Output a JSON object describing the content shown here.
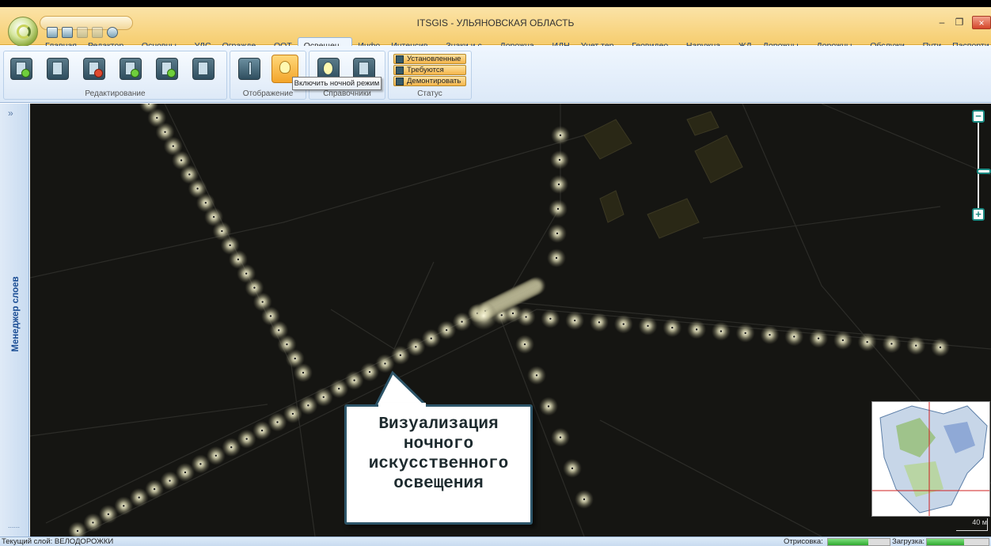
{
  "app": {
    "title": "ITSGIS - УЛЬЯНОВСКАЯ ОБЛАСТЬ",
    "window_buttons": {
      "minimize": "–",
      "restore": "❐",
      "close": "×"
    }
  },
  "ribbon_tabs": [
    "Главная",
    "Редактор...",
    "Основны...",
    "УДС",
    "Огражде...",
    "ООТ",
    "Освещен...",
    "Инфо",
    "Интенсив...",
    "Знаки и с...",
    "Дорожна...",
    "ИДН",
    "Учет тер...",
    "Геовидео...",
    "Наружна...",
    "ЖД",
    "Дорожны...",
    "Дорожны...",
    "Обслужи...",
    "Пути",
    "Паспорти..."
  ],
  "active_tab_index": 6,
  "ribbon": {
    "groups": {
      "editing": "Редактирование",
      "display": "Отображение",
      "references": "Справочники",
      "status": "Статус"
    },
    "status_buttons": [
      "Установленные",
      "Требуются",
      "Демонтировать"
    ],
    "tooltip": "Включить ночной режим"
  },
  "sidebar": {
    "label": "Менеджер слоев",
    "toggle": "»",
    "bottom": "......"
  },
  "map": {
    "callout": "Визуализация\nночного\nискусственного\nосвещения",
    "scale_label": "40 м",
    "zoom_in": "+",
    "zoom_out": "−"
  },
  "status_bar": {
    "current_layer": "Текущий слой: ВЕЛОДОРОЖКИ",
    "render_label": "Отрисовка:",
    "render_progress": 0.65,
    "load_label": "Загрузка:",
    "load_progress": 0.6
  },
  "colors": {
    "map_background": "#151512",
    "lamp_glow": "#f4f1c8",
    "callout_border": "#2d5569",
    "accent_teal": "#1a8a82"
  }
}
